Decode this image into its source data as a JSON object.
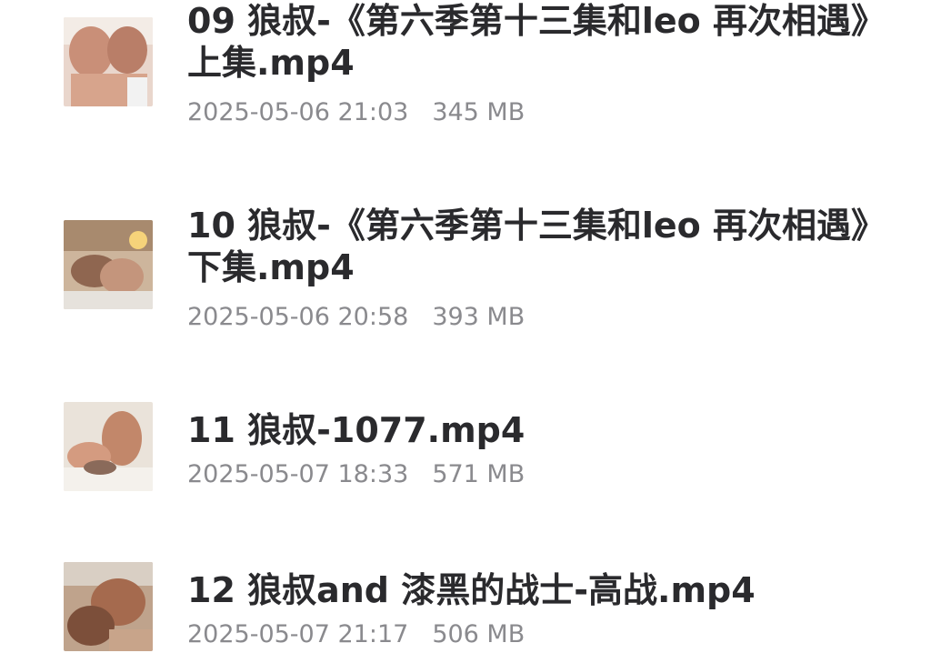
{
  "files": [
    {
      "name": "09 狼叔-《第六季第十三集和leo 再次相遇》上集.mp4",
      "date": "2025-05-06 21:03",
      "size": "345 MB",
      "thumbnail_icon": "video-thumbnail"
    },
    {
      "name": "10 狼叔-《第六季第十三集和leo 再次相遇》下集.mp4",
      "date": "2025-05-06 20:58",
      "size": "393 MB",
      "thumbnail_icon": "video-thumbnail"
    },
    {
      "name": "11 狼叔-1077.mp4",
      "date": "2025-05-07 18:33",
      "size": "571 MB",
      "thumbnail_icon": "video-thumbnail"
    },
    {
      "name": "12 狼叔and 漆黑的战士-高战.mp4",
      "date": "2025-05-07 21:17",
      "size": "506 MB",
      "thumbnail_icon": "video-thumbnail"
    }
  ]
}
